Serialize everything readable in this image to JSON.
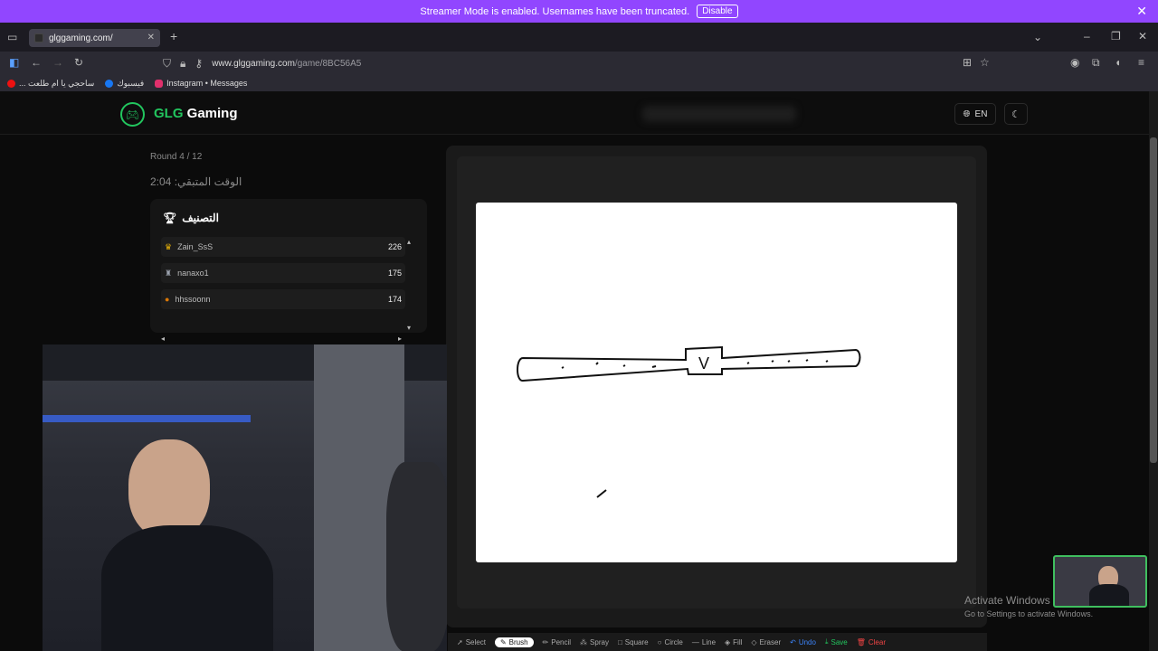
{
  "banner": {
    "text": "Streamer Mode is enabled. Usernames have been truncated.",
    "button": "Disable"
  },
  "browser": {
    "tab_title": "glggaming.com/",
    "url_host": "www.glggaming.com",
    "url_path": "/game/8BC56A5",
    "bookmarks": [
      "... ساحجي يا ام طلعت",
      "فيسبوك",
      "Instagram • Messages"
    ]
  },
  "app": {
    "brand_prefix": "GLG",
    "brand_suffix": " Gaming",
    "lang": "EN",
    "round": "Round 4 / 12",
    "timer": "الوقت المتبقي: 2:04",
    "ranking_title": "التصنيف",
    "players": [
      {
        "name": "Zain_SsS",
        "score": "226",
        "badge_color": "#eab308"
      },
      {
        "name": "nanaxo1",
        "score": "175",
        "badge_color": "#9ca3af"
      },
      {
        "name": "hhssoonn",
        "score": "174",
        "badge_color": "#d97706"
      }
    ]
  },
  "toolbar": {
    "tools": [
      "Select",
      "Brush",
      "Pencil",
      "Spray",
      "Square",
      "Circle",
      "Line",
      "Fill",
      "Eraser",
      "Undo",
      "Save",
      "Clear"
    ],
    "active": "Brush"
  },
  "drawing_text": "V",
  "windows": {
    "line1": "Activate Windows",
    "line2": "Go to Settings to activate Windows."
  },
  "colors": {
    "brand": "#22c55e",
    "banner": "#9146ff"
  }
}
